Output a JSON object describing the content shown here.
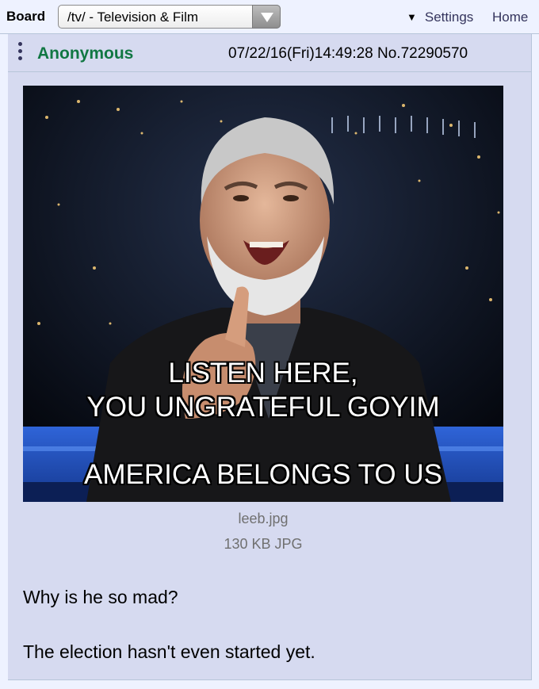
{
  "topbar": {
    "board_label": "Board",
    "board_select_value": "/tv/ - Television & Film",
    "settings_label": "Settings",
    "home_label": "Home"
  },
  "post": {
    "name": "Anonymous",
    "datetime": "07/22/16(Fri)14:49:28 No.72290570",
    "image": {
      "caption_line1": "LISTEN HERE,",
      "caption_line2": "YOU UNGRATEFUL GOYIM",
      "caption_line3": "AMERICA BELONGS TO US",
      "file_name": "leeb.jpg",
      "file_info": "130 KB JPG"
    },
    "comment": [
      "Why is he so mad?",
      "The election hasn't even started yet."
    ]
  },
  "colors": {
    "page_bg": "#eef2ff",
    "post_bg": "#d6daf0",
    "name": "#117743",
    "link": "#34345c",
    "border": "#b7c5d9"
  }
}
